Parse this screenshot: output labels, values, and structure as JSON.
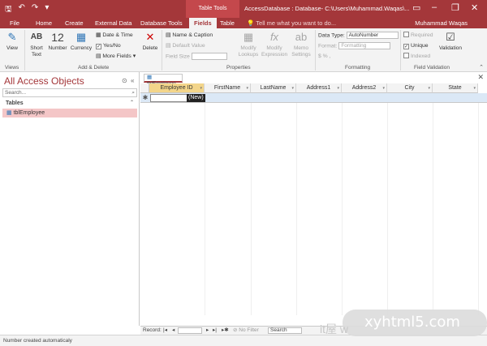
{
  "app": {
    "title": "AccessDatabase : Database- C:\\Users\\Muhammad.Waqas\\...",
    "contextual_group": "Table Tools",
    "user": "Muhammad Waqas",
    "tell_me": "Tell me what you want to do..."
  },
  "colors": {
    "accent": "#a4373a",
    "selected_row": "#dbe8f6",
    "selected_nav": "#f4c6c7",
    "header_highlight": "#f3d58a"
  },
  "tabs": [
    "File",
    "Home",
    "Create",
    "External Data",
    "Database Tools",
    "Fields",
    "Table"
  ],
  "active_tab": "Fields",
  "ribbon": {
    "views": {
      "label": "View",
      "group": "Views"
    },
    "add_delete": {
      "group": "Add & Delete",
      "short_text": "Short Text",
      "number_label": "12",
      "number": "Number",
      "currency": "Currency",
      "date_time": "Date & Time",
      "yes_no": "Yes/No",
      "more_fields": "More Fields",
      "delete": "Delete"
    },
    "properties": {
      "group": "Properties",
      "name_caption": "Name & Caption",
      "default_value": "Default Value",
      "field_size": "Field Size",
      "modify_lookups": "Modify Lookups",
      "modify_expression": "Modify Expression",
      "memo_settings": "Memo Settings"
    },
    "formatting": {
      "group": "Formatting",
      "data_type_label": "Data Type:",
      "data_type_value": "AutoNumber",
      "format_label": "Format:",
      "format_value": "Formatting",
      "symbols": "$ % ,"
    },
    "field_validation": {
      "group": "Field Validation",
      "required": "Required",
      "unique": "Unique",
      "indexed": "Indexed",
      "validation": "Validation"
    }
  },
  "nav_pane": {
    "title": "All Access Objects",
    "search_placeholder": "Search...",
    "section": "Tables",
    "items": [
      "tblEmployee"
    ]
  },
  "document": {
    "tab": "tblEmployee",
    "columns": [
      "Employee ID",
      "FirstName",
      "LastName",
      "Address1",
      "Address2",
      "City",
      "State"
    ],
    "new_row_label": "(New)"
  },
  "record_nav": {
    "record_label": "Record:",
    "filter_label": "No Filter",
    "search_label": "Search"
  },
  "status": "Number created automaticaly",
  "watermark": {
    "text": "xyhtml5.com",
    "cn": "it屋 w"
  }
}
